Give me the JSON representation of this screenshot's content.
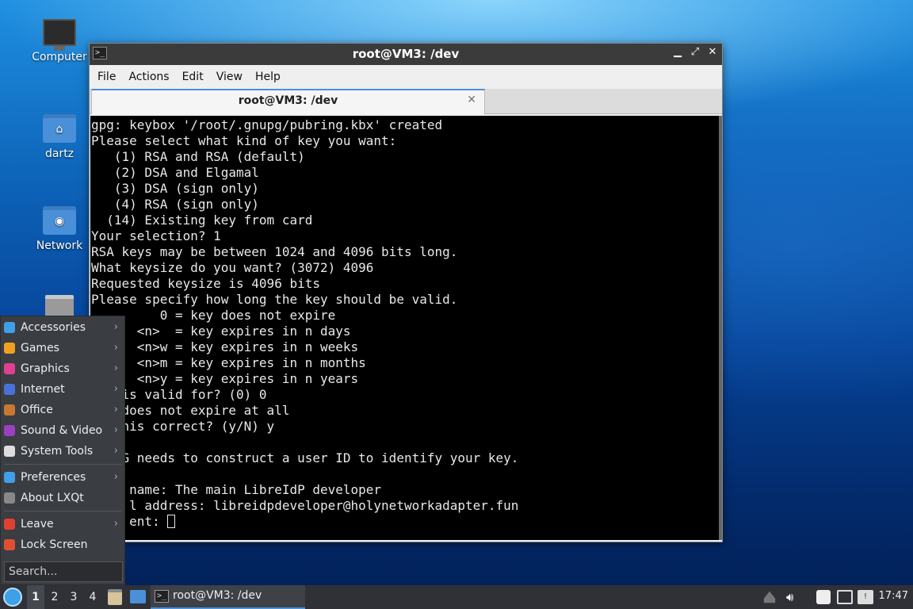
{
  "desktop": {
    "icons": [
      {
        "label": "Computer"
      },
      {
        "label": "dartz"
      },
      {
        "label": "Network"
      }
    ]
  },
  "window": {
    "title": "root@VM3: /dev",
    "menu": [
      "File",
      "Actions",
      "Edit",
      "View",
      "Help"
    ],
    "tab_label": "root@VM3: /dev",
    "tab_close": "✕"
  },
  "terminal": {
    "lines": [
      "gpg: keybox '/root/.gnupg/pubring.kbx' created",
      "Please select what kind of key you want:",
      "   (1) RSA and RSA (default)",
      "   (2) DSA and Elgamal",
      "   (3) DSA (sign only)",
      "   (4) RSA (sign only)",
      "  (14) Existing key from card",
      "Your selection? 1",
      "RSA keys may be between 1024 and 4096 bits long.",
      "What keysize do you want? (3072) 4096",
      "Requested keysize is 4096 bits",
      "Please specify how long the key should be valid.",
      "         0 = key does not expire",
      "      <n>  = key expires in n days",
      "      <n>w = key expires in n weeks",
      "      <n>m = key expires in n months",
      "      <n>y = key expires in n years",
      "    is valid for? (0) 0",
      "    does not expire at all",
      "    his correct? (y/N) y",
      "",
      "    G needs to construct a user ID to identify your key.",
      "",
      "     name: The main LibreIdP developer",
      "     l address: libreidpdeveloper@holynetworkadapter.fun",
      "     ent: "
    ]
  },
  "startmenu": {
    "items": [
      {
        "label": "Accessories",
        "color": "#3fa0e8",
        "submenu": true
      },
      {
        "label": "Games",
        "color": "#f0a020",
        "submenu": true
      },
      {
        "label": "Graphics",
        "color": "#e04090",
        "submenu": true
      },
      {
        "label": "Internet",
        "color": "#4a70d9",
        "submenu": true
      },
      {
        "label": "Office",
        "color": "#c87830",
        "submenu": true
      },
      {
        "label": "Sound & Video",
        "color": "#9a40c0",
        "submenu": true
      },
      {
        "label": "System Tools",
        "color": "#dddddd",
        "submenu": true
      }
    ],
    "items2": [
      {
        "label": "Preferences",
        "color": "#3fa0e8",
        "submenu": true
      },
      {
        "label": "About LXQt",
        "color": "#888888",
        "submenu": false
      }
    ],
    "items3": [
      {
        "label": "Leave",
        "color": "#e04030",
        "submenu": true
      },
      {
        "label": "Lock Screen",
        "color": "#e05030",
        "submenu": false
      }
    ],
    "search_placeholder": "Search...",
    "arrow": "›"
  },
  "taskbar": {
    "desktops": [
      "1",
      "2",
      "3",
      "4"
    ],
    "active_desktop": "1",
    "task_label": "root@VM3: /dev",
    "clock": "17:47"
  }
}
